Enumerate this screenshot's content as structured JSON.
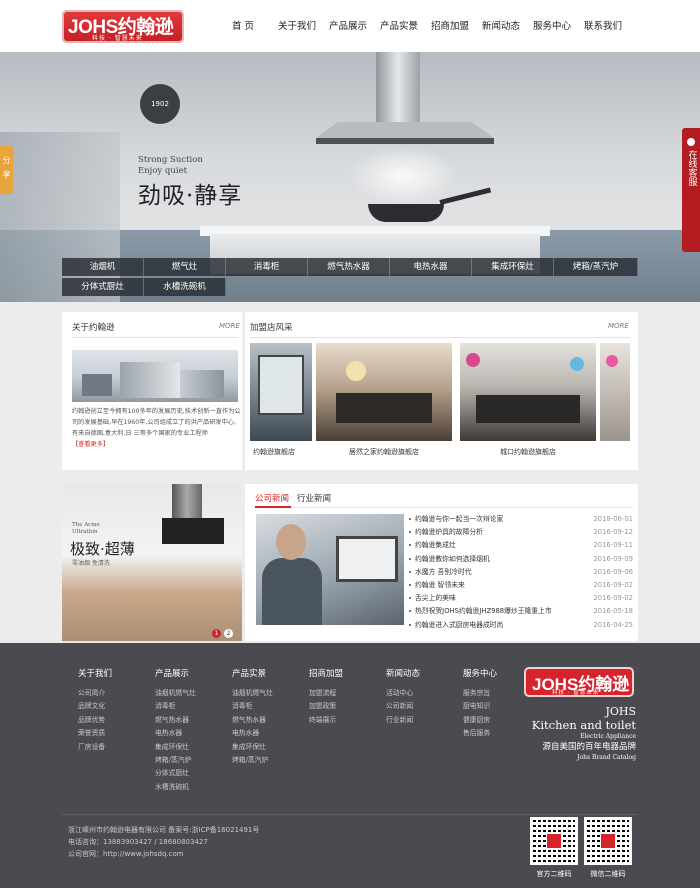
{
  "header": {
    "logo_text": "JOHS约翰逊",
    "logo_tagline": "科技 · 智慧未来",
    "nav": [
      "首  页",
      "关于我们",
      "产品展示",
      "产品实景",
      "招商加盟",
      "新闻动态",
      "服务中心",
      "联系我们"
    ]
  },
  "banner": {
    "badge_year": "1902",
    "slogan_en_1": "Strong Suction",
    "slogan_en_2": "Enjoy quiet",
    "slogan_cn": "劲吸·静享",
    "categories_row1": [
      "油烟机",
      "燃气灶",
      "消毒柜",
      "燃气热水器",
      "电热水器",
      "集成环保灶",
      "烤箱/蒸汽炉"
    ],
    "categories_row2": [
      "分体式厨灶",
      "水槽洗碗机"
    ]
  },
  "float": {
    "share": "分享",
    "service": "在线客服"
  },
  "about": {
    "title": "关于约翰逊",
    "more": "MORE",
    "text": "约翰逊创立至今拥有100多年的发展历史,技术创新一直作为公司的发展基础,早在1960年,公司组成立了的洪产品研发中心,有来自德国,意大利,日 三等多个国家的专业工程师",
    "read_more": "【查看更多】"
  },
  "stores": {
    "title": "加盟店风采",
    "more": "MORE",
    "captions": [
      "约翰逊旗舰店",
      "居然之家约翰逊旗舰店",
      "城口约翰逊旗舰店"
    ]
  },
  "promo": {
    "en_1": "The Acme",
    "en_2": "Ultrathin",
    "cn": "极致·超薄",
    "sub": "零油烟 免清洗",
    "pages": [
      "1",
      "2"
    ]
  },
  "news": {
    "tabs": [
      "公司新闻",
      "行业新闻"
    ],
    "items": [
      {
        "title": "约翰逊与你一起当一次辩论家",
        "date": "2018-06-01"
      },
      {
        "title": "约翰逊炉具的故障分析",
        "date": "2016-09-12"
      },
      {
        "title": "约翰逊集成灶",
        "date": "2016-09-11"
      },
      {
        "title": "约翰逊教你如何选择烟机",
        "date": "2016-09-09"
      },
      {
        "title": "水魔方 吾别冷时代",
        "date": "2016-09-06"
      },
      {
        "title": "约翰逊 智领未来",
        "date": "2016-09-02"
      },
      {
        "title": "舌尖上的美味",
        "date": "2016-09-02"
      },
      {
        "title": "热烈祝贺JOHS约翰逊JHZ988爆炒王隆重上市",
        "date": "2016-05-18"
      },
      {
        "title": "约翰逊进入式厨房电器成时尚",
        "date": "2016-04-25"
      }
    ]
  },
  "footer": {
    "columns": [
      {
        "heading": "关于我们",
        "links": [
          "公司简介",
          "品牌文化",
          "品牌优势",
          "荣誉资质",
          "厂房设备"
        ]
      },
      {
        "heading": "产品展示",
        "links": [
          "油烟机燃气灶",
          "消毒柜",
          "燃气热水器",
          "电热水器",
          "集成环保灶",
          "烤箱/蒸汽炉",
          "分体式厨灶",
          "水槽洗碗机"
        ]
      },
      {
        "heading": "产品实景",
        "links": [
          "油烟机燃气灶",
          "消毒柜",
          "燃气热水器",
          "电热水器",
          "集成环保灶",
          "烤箱/蒸汽炉"
        ]
      },
      {
        "heading": "招商加盟",
        "links": [
          "加盟流程",
          "加盟政策",
          "终端展示"
        ]
      },
      {
        "heading": "新闻动态",
        "links": [
          "活动中心",
          "公司新闻",
          "行业新闻"
        ]
      },
      {
        "heading": "服务中心",
        "links": [
          "服务宗旨",
          "厨电知识",
          "健康厨房",
          "售后服务"
        ]
      }
    ],
    "logo_text": "JOHS约翰逊",
    "logo_tagline": "科技 · 智慧未来",
    "brand_1": "JOHS",
    "brand_2": "Kitchen and toilet",
    "brand_3": "Electric Appliance",
    "brand_cn": "源自美国的百年电器品牌",
    "brand_4": "Johs Brand Catalog",
    "copyright": "浙江嵊州市约翰逊电器有限公司 备案号:浙ICP备16021491号",
    "phone": "电话咨询：13883903427 / 18680803427",
    "website": "公司官网：http://www.johsdq.com",
    "qr_captions": [
      "官方二维码",
      "微信二维码"
    ]
  },
  "colors": {
    "brand_red": "#d7232b",
    "footer_bg": "#4a4a51",
    "service_red": "#b31c21",
    "share_orange": "#e9a43a"
  }
}
